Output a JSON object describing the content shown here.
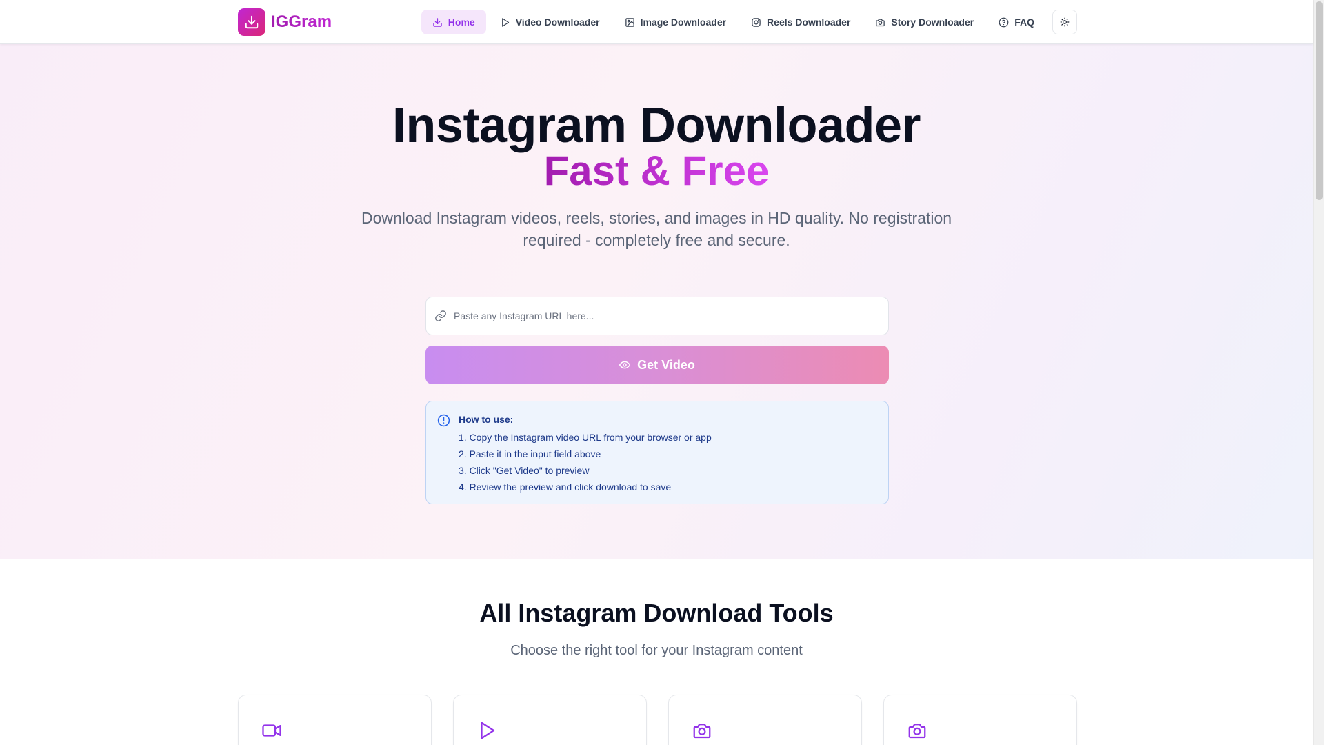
{
  "brand": {
    "name": "IGGram",
    "accent": "#c026d3"
  },
  "nav": {
    "items": [
      {
        "label": "Home",
        "icon": "download-icon",
        "active": true
      },
      {
        "label": "Video Downloader",
        "icon": "play-icon"
      },
      {
        "label": "Image Downloader",
        "icon": "image-icon"
      },
      {
        "label": "Reels Downloader",
        "icon": "instagram-icon"
      },
      {
        "label": "Story Downloader",
        "icon": "camera-icon"
      },
      {
        "label": "FAQ",
        "icon": "help-circle-icon"
      }
    ],
    "theme_toggle_icon": "sun-icon"
  },
  "hero": {
    "title": "Instagram Downloader",
    "subtitle": "Fast & Free",
    "description": "Download Instagram videos, reels, stories, and images in HD quality. No registration required - completely free and secure."
  },
  "search": {
    "placeholder": "Paste any Instagram URL here...",
    "value": "",
    "icon": "link-icon"
  },
  "get_button": {
    "label": "Get Video",
    "icon": "eye-icon"
  },
  "howto": {
    "icon": "info-circle-icon",
    "title": "How to use:",
    "steps": [
      "1. Copy the Instagram video URL from your browser or app",
      "2. Paste it in the input field above",
      "3. Click \"Get Video\" to preview",
      "4. Review the preview and click download to save"
    ]
  },
  "tools": {
    "title": "All Instagram Download Tools",
    "description": "Choose the right tool for your Instagram content",
    "cards": [
      {
        "icon": "video-camera-icon"
      },
      {
        "icon": "play-icon"
      },
      {
        "icon": "camera-icon"
      },
      {
        "icon": "camera-icon"
      }
    ]
  }
}
